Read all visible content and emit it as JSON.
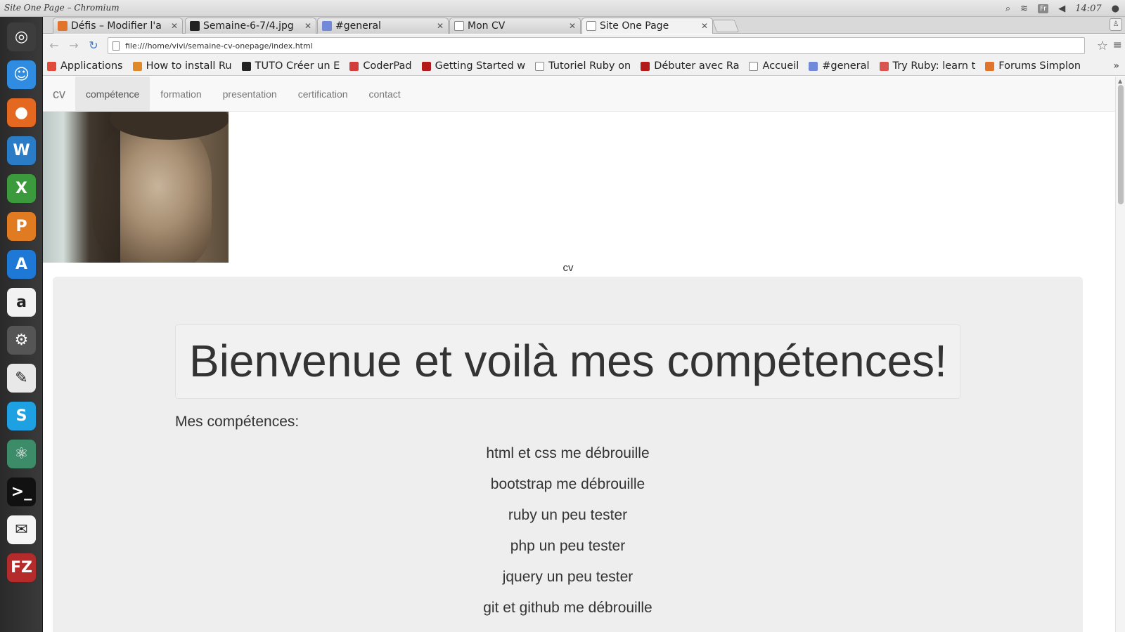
{
  "os": {
    "window_title": "Site One Page – Chromium",
    "clock": "14:07",
    "keyboard_layout": "Fr"
  },
  "launcher": {
    "items": [
      {
        "name": "ubuntu-dash",
        "color": "#3d3d3d",
        "glyph": "◎"
      },
      {
        "name": "finder",
        "color": "#2f8ce0",
        "glyph": "☺"
      },
      {
        "name": "firefox",
        "color": "#e4681f",
        "glyph": "●"
      },
      {
        "name": "writer",
        "color": "#2a7cc7",
        "glyph": "W"
      },
      {
        "name": "calc",
        "color": "#3b9a3b",
        "glyph": "X"
      },
      {
        "name": "impress",
        "color": "#e07b22",
        "glyph": "P"
      },
      {
        "name": "app-store",
        "color": "#1e78d6",
        "glyph": "A"
      },
      {
        "name": "amazon",
        "color": "#f2f2f2",
        "glyph": "a"
      },
      {
        "name": "settings",
        "color": "#555555",
        "glyph": "⚙"
      },
      {
        "name": "text-editor",
        "color": "#e8e8e8",
        "glyph": "✎"
      },
      {
        "name": "skype",
        "color": "#1da1e2",
        "glyph": "S"
      },
      {
        "name": "atom",
        "color": "#3c8c6a",
        "glyph": "⚛"
      },
      {
        "name": "terminal",
        "color": "#111111",
        "glyph": ">_"
      },
      {
        "name": "mail",
        "color": "#f5f5f5",
        "glyph": "✉"
      },
      {
        "name": "filezilla",
        "color": "#b52b2b",
        "glyph": "FZ"
      }
    ]
  },
  "browser": {
    "tabs": [
      {
        "label": "Défis – Modifier l'a",
        "favicon_color": "#e2732a"
      },
      {
        "label": "Semaine-6-7/4.jpg",
        "favicon_color": "#222222"
      },
      {
        "label": "#general",
        "favicon_color": "#7289da"
      },
      {
        "label": "Mon CV",
        "favicon_color": "#ffffff"
      },
      {
        "label": "Site One Page",
        "favicon_color": "#ffffff"
      }
    ],
    "url": "file:///home/vivi/semaine-cv-onepage/index.html",
    "bookmarks": [
      {
        "label": "Applications",
        "color": "#e04b3a"
      },
      {
        "label": "How to install Ru",
        "color": "#e0892a"
      },
      {
        "label": "TUTO Créer un E",
        "color": "#222222"
      },
      {
        "label": "CoderPad",
        "color": "#d23c3c"
      },
      {
        "label": "Getting Started w",
        "color": "#b31b1b"
      },
      {
        "label": "Tutoriel Ruby on",
        "color": "#ffffff"
      },
      {
        "label": "Débuter avec Ra",
        "color": "#b31b1b"
      },
      {
        "label": "Accueil",
        "color": "#ffffff"
      },
      {
        "label": "#general",
        "color": "#7289da"
      },
      {
        "label": "Try Ruby: learn t",
        "color": "#d9534f"
      },
      {
        "label": "Forums Simplon",
        "color": "#e2732a"
      }
    ],
    "bookmarks_more": "»"
  },
  "site": {
    "brand": "cv",
    "nav": [
      "compétence",
      "formation",
      "presentation",
      "certification",
      "contact"
    ],
    "active_nav": "compétence",
    "photo_caption": "cv",
    "heading": "Bienvenue et voilà mes compétences!",
    "skills_title": "Mes compétences:",
    "skills": [
      "html et css me débrouille",
      "bootstrap me débrouille",
      "ruby un peu tester",
      "php un peu tester",
      "jquery un peu tester",
      "git et github me débrouille"
    ]
  }
}
